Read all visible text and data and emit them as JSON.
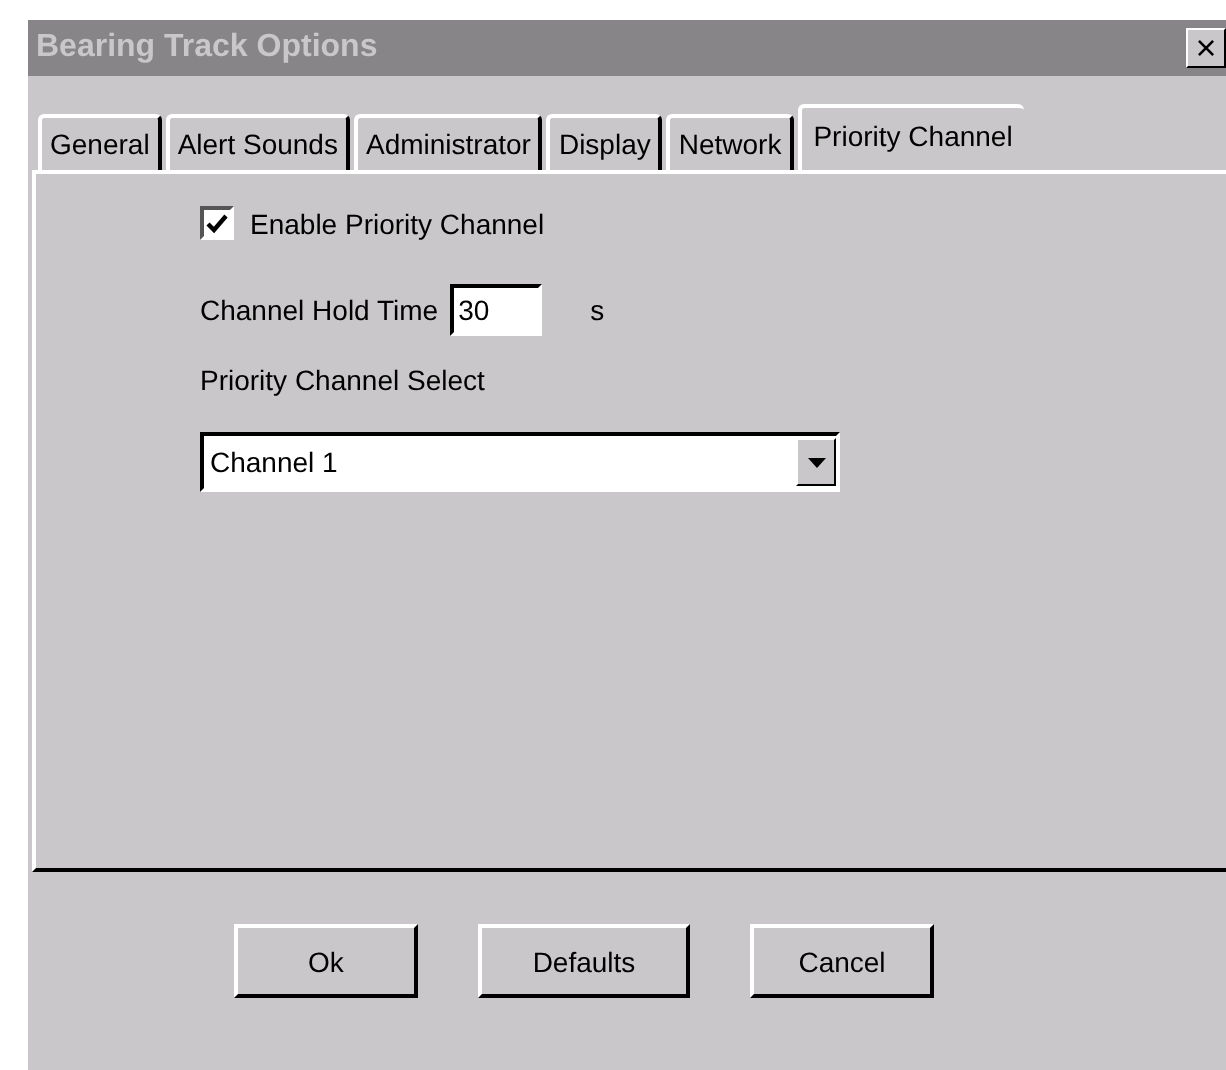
{
  "window": {
    "title": "Bearing Track Options",
    "close": "×"
  },
  "tabs": [
    {
      "label": "General",
      "selected": false
    },
    {
      "label": "Alert Sounds",
      "selected": false
    },
    {
      "label": "Administrator",
      "selected": false
    },
    {
      "label": "Display",
      "selected": false
    },
    {
      "label": "Network",
      "selected": false
    },
    {
      "label": "Priority Channel",
      "selected": true
    }
  ],
  "enable_priority": {
    "label": "Enable Priority Channel",
    "checked": true
  },
  "hold_time": {
    "label": "Channel Hold Time",
    "value": "30",
    "unit": "s"
  },
  "channel_select": {
    "label": "Priority Channel Select",
    "value": "Channel 1"
  },
  "buttons": [
    "Ok",
    "Defaults",
    "Cancel"
  ]
}
